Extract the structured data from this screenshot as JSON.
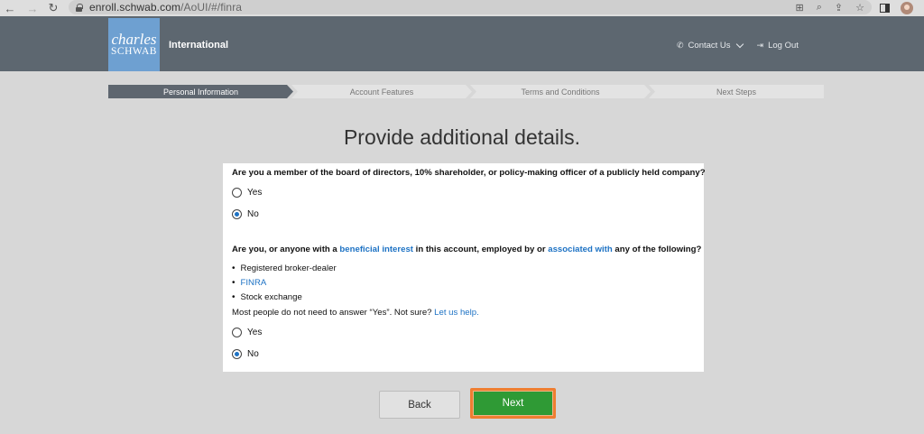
{
  "browser": {
    "url_host": "enroll.schwab.com",
    "url_path": "/AoUI/#/finra"
  },
  "header": {
    "logo_line1": "charles",
    "logo_line2": "SCHWAB",
    "subtitle": "International",
    "contact_label": "Contact Us",
    "logout_label": "Log Out"
  },
  "steps": [
    {
      "label": "Personal Information",
      "active": true
    },
    {
      "label": "Account Features",
      "active": false
    },
    {
      "label": "Terms and Conditions",
      "active": false
    },
    {
      "label": "Next Steps",
      "active": false
    }
  ],
  "page_title": "Provide additional details.",
  "question1": {
    "text": "Are you a member of the board of directors, 10% shareholder, or policy-making officer of a publicly held company?",
    "options": [
      "Yes",
      "No"
    ],
    "selected": "No"
  },
  "question2": {
    "text_a": "Are you, or anyone with a ",
    "link1": "beneficial interest",
    "text_b": " in this account, employed by or ",
    "link2": "associated with",
    "text_c": " any of the following?",
    "bullets": [
      "Registered broker-dealer",
      "FINRA",
      "Stock exchange"
    ],
    "note_text": "Most people do not need to answer “Yes”. Not sure?",
    "note_link": "Let us help.",
    "options": [
      "Yes",
      "No"
    ],
    "selected": "No"
  },
  "buttons": {
    "back": "Back",
    "next": "Next"
  },
  "colors": {
    "header_bg": "#5d6770",
    "logo_bg": "#6ea0d1",
    "link": "#1d72c4",
    "next_bg": "#2f9a35",
    "highlight": "#ef7e31"
  }
}
